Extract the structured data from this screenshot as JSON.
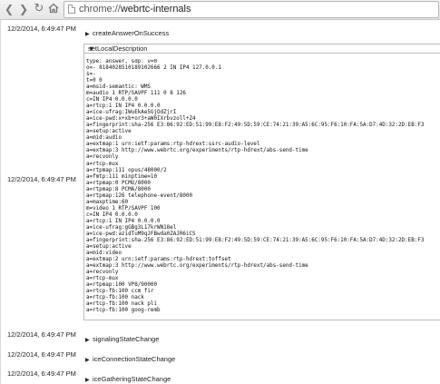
{
  "browser": {
    "url_scheme": "chrome://",
    "url_host": "webrtc-internals"
  },
  "log": {
    "entries": [
      {
        "timestamp": "12/2/2014, 6:49:47 PM",
        "event": "createAnswerOnSuccess"
      },
      {
        "timestamp": "12/2/2014, 6:49:47 PM",
        "event": "setLocalDescription"
      },
      {
        "timestamp": "12/2/2014, 6:49:47 PM",
        "event": "signalingStateChange"
      },
      {
        "timestamp": "12/2/2014, 6:49:47 PM",
        "event": "iceConnectionStateChange"
      },
      {
        "timestamp": "12/2/2014, 6:49:47 PM",
        "event": "iceGatheringStateChange"
      }
    ],
    "sdp_lines": [
      "type: answer, sdp: v=0",
      "o=- 8184028510189102666 2 IN IP4 127.0.0.1",
      "s=-",
      "t=0 0",
      "a=msid-semantic: WMS",
      "m=audio 1 RTP/SAVPF 111 0 8 126",
      "c=IN IP4 0.0.0.0",
      "a=rtcp:1 IN IP4 0.0.0.0",
      "a=ice-ufrag:IWuEkAe5GjOdZjrI",
      "a=ice-pwd:x+xb+or3+aW0IXrbvzoll+Z4",
      "a=fingerprint:sha-256 E3:86:92:ED:51:99:E8:F2:49:5D:59:CE:74:21:39:A5:6C:95:F6:10:FA:5A:D7:4D:32:2D:EB:F3",
      "a=setup:active",
      "a=mid:audio",
      "a=extmap:1 urn:ietf:params:rtp-hdrext:ssrc-audio-level",
      "a=extmap:3 http://www.webrtc.org/experiments/rtp-hdrext/abs-send-time",
      "a=recvonly",
      "a=rtcp-mux",
      "a=rtpmap:111 opus/48000/2",
      "a=fmtp:111 minptime=10",
      "a=rtpmap:0 PCMU/8000",
      "a=rtpmap:8 PCMA/8000",
      "a=rtpmap:126 telephone-event/8000",
      "a=maxptime:60",
      "m=video 1 RTP/SAVPF 100",
      "c=IN IP4 0.0.0.0",
      "a=rtcp:1 IN IP4 0.0.0.0",
      "a=ice-ufrag:gGBg3L17krWN18el",
      "a=ice-pwd:azidTuM9qJFBwda0ZAJR6iCS",
      "a=fingerprint:sha-256 E3:86:92:ED:51:99:E8:F2:49:5D:59:CE:74:21:39:A5:6C:95:F6:10:FA:5A:D7:4D:32:2D:EB:F3",
      "a=setup:active",
      "a=mid:video",
      "a=extmap:2 urn:ietf:params:rtp-hdrext:toffset",
      "a=extmap:3 http://www.webrtc.org/experiments/rtp-hdrext/abs-send-time",
      "a=recvonly",
      "a=rtcp-mux",
      "a=rtpmap:100 VP8/90000",
      "a=rtcp-fb:100 ccm fir",
      "a=rtcp-fb:100 nack",
      "a=rtcp-fb:100 nack pli",
      "a=rtcp-fb:100 goog-remb"
    ]
  },
  "icons": {
    "back": "back-arrow-icon",
    "forward": "forward-arrow-icon",
    "reload": "reload-icon",
    "home": "home-icon",
    "page": "page-icon",
    "collapsed": "triangle-right-icon",
    "expanded": "triangle-down-icon"
  }
}
